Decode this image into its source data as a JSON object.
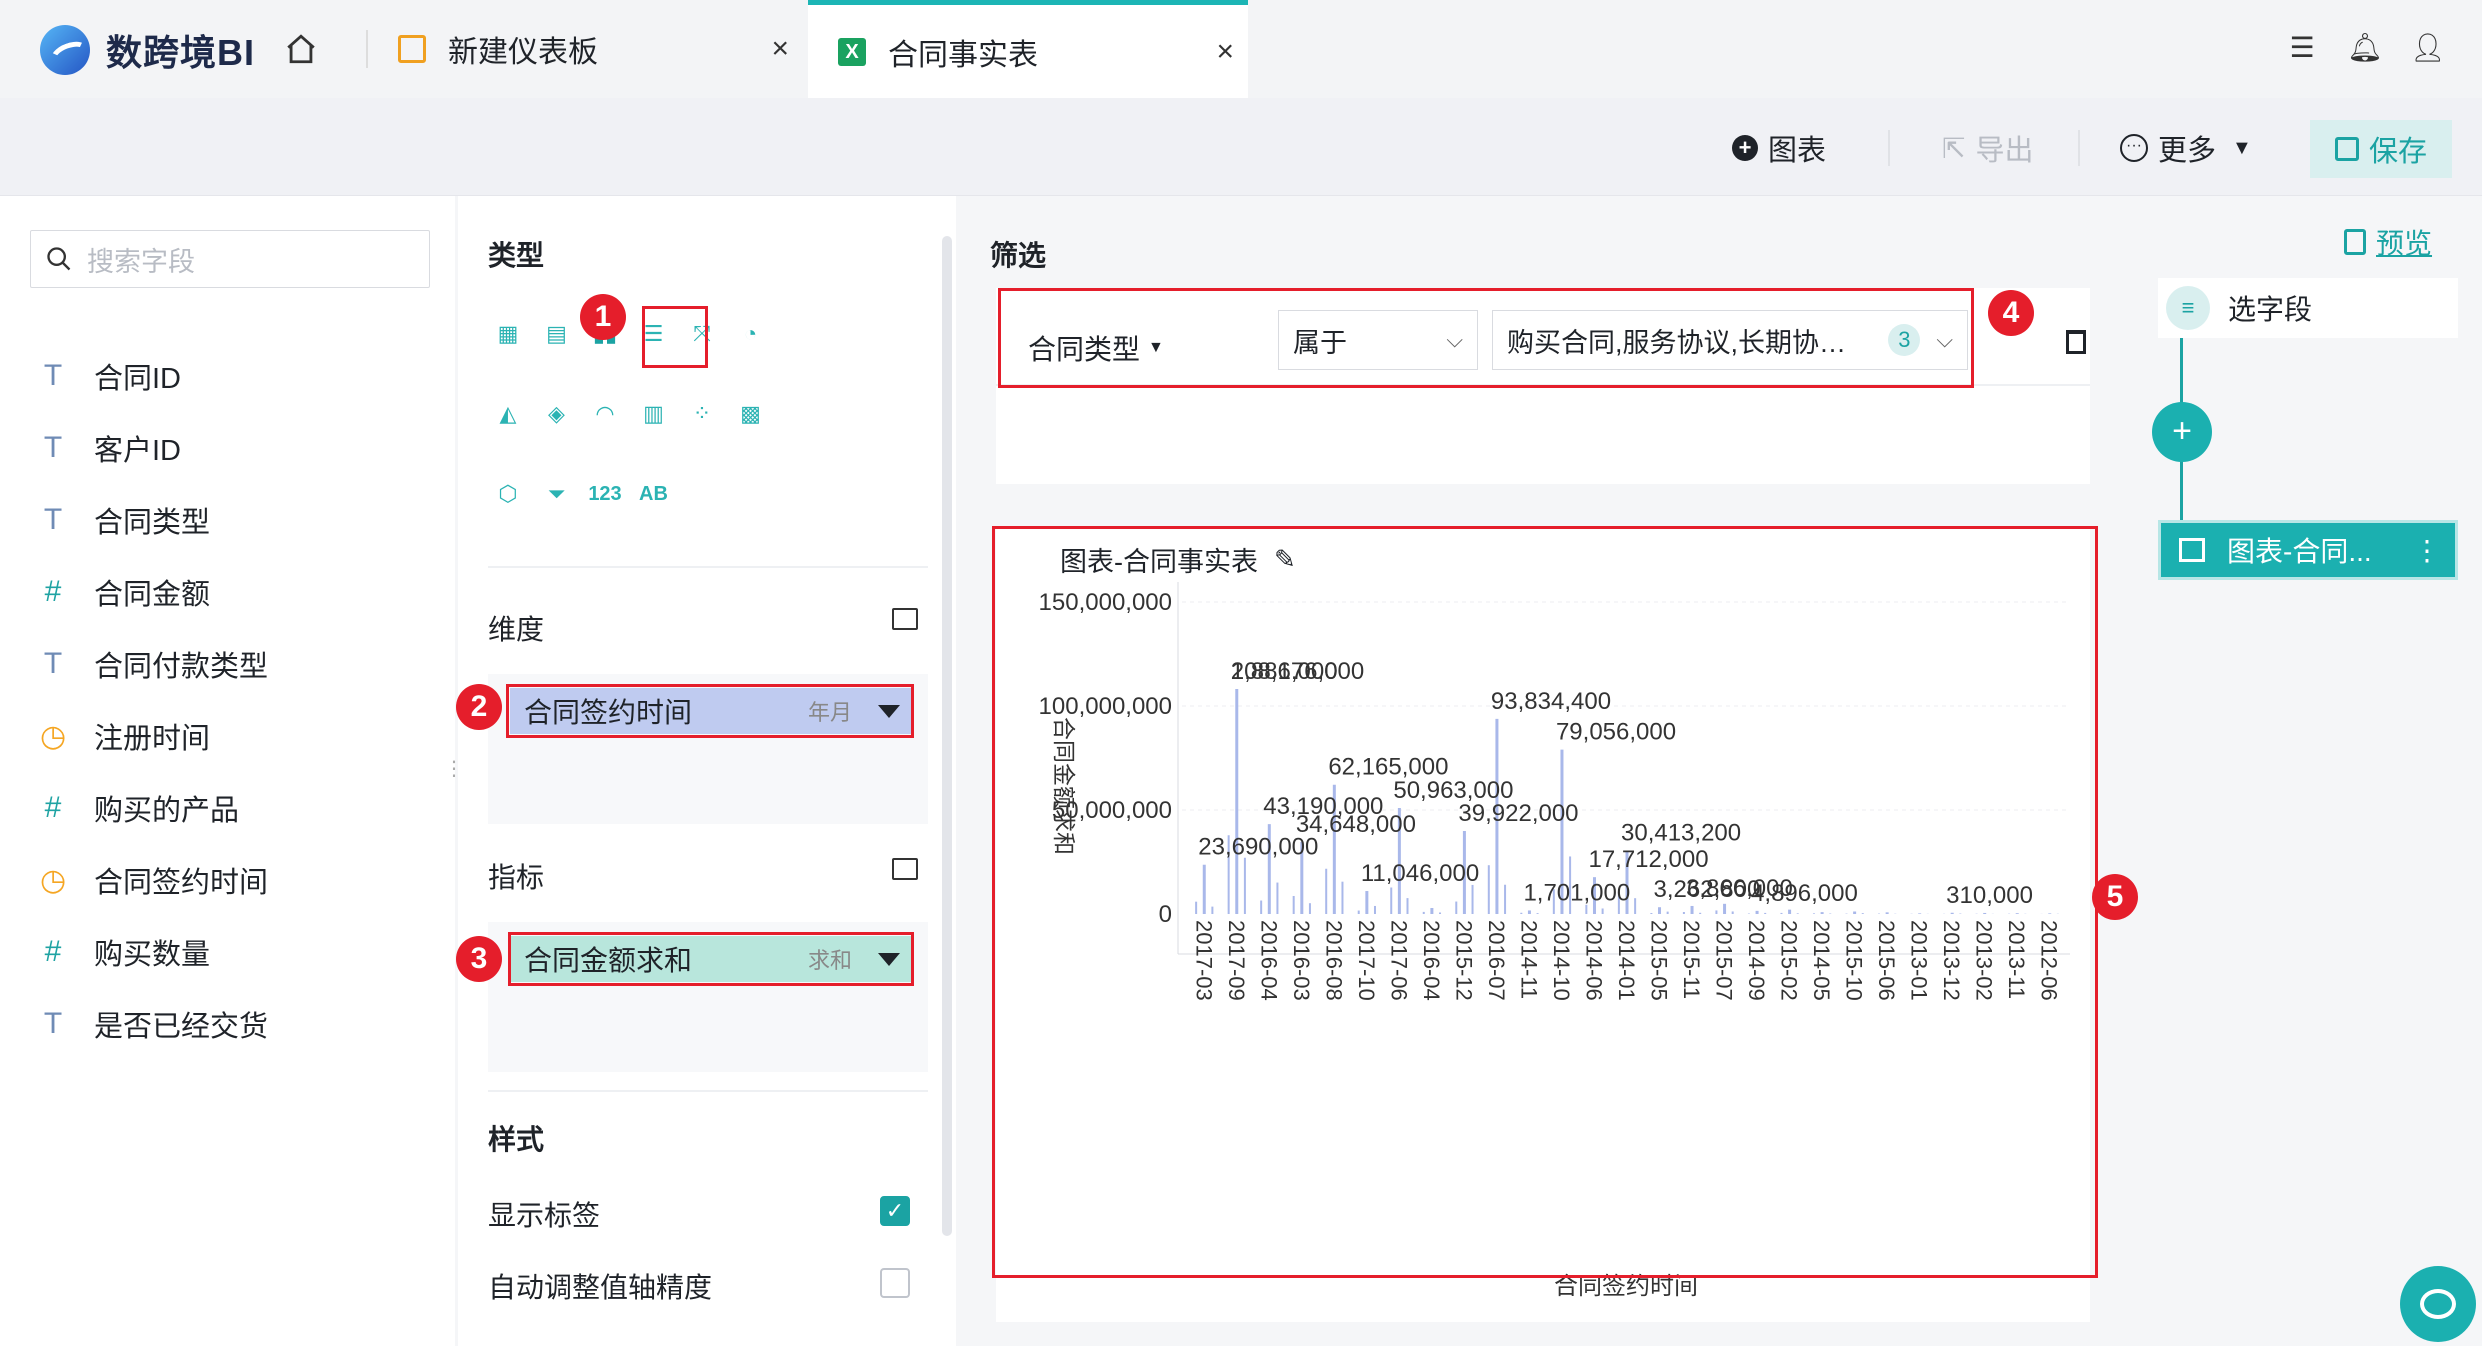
{
  "app": {
    "name": "数跨境BI"
  },
  "tabs": [
    {
      "label": "新建仪表板"
    },
    {
      "label": "合同事实表"
    }
  ],
  "toolbar": {
    "chart": "图表",
    "export": "导出",
    "more": "更多",
    "save": "保存"
  },
  "fields": {
    "search_placeholder": "搜索字段",
    "items": [
      {
        "type": "T",
        "label": "合同ID"
      },
      {
        "type": "T",
        "label": "客户ID"
      },
      {
        "type": "T",
        "label": "合同类型"
      },
      {
        "type": "#",
        "label": "合同金额"
      },
      {
        "type": "T",
        "label": "合同付款类型"
      },
      {
        "type": "D",
        "label": "注册时间"
      },
      {
        "type": "#",
        "label": "购买的产品"
      },
      {
        "type": "D",
        "label": "合同签约时间"
      },
      {
        "type": "#",
        "label": "购买数量"
      },
      {
        "type": "T",
        "label": "是否已经交货"
      }
    ]
  },
  "config": {
    "type_title": "类型",
    "dimension_title": "维度",
    "dimension_pill": {
      "label": "合同签约时间",
      "agg": "年月"
    },
    "metric_title": "指标",
    "metric_pill": {
      "label": "合同金额求和",
      "agg": "求和"
    },
    "style_title": "样式",
    "show_labels": {
      "label": "显示标签",
      "checked": true
    },
    "auto_axis": {
      "label": "自动调整值轴精度",
      "checked": false
    },
    "chart_icons": [
      "table-icon",
      "cross-table-icon",
      "bar-chart-icon",
      "horizontal-bar-icon",
      "line-chart-icon",
      "pie-chart-icon",
      "area-chart-icon",
      "china-map-icon",
      "gauge-icon",
      "stacked-bar-icon",
      "scatter-icon",
      "treemap-icon",
      "radar-icon",
      "funnel-icon",
      "number-card-icon",
      "word-cloud-icon"
    ],
    "number_card_text": "123",
    "word_cloud_text": "AB"
  },
  "filter": {
    "title": "筛选",
    "field": "合同类型",
    "op": "属于",
    "values": "购买合同,服务协议,长期协…",
    "count": "3"
  },
  "chart_title": "图表-合同事实表",
  "chart_data": {
    "type": "bar",
    "xlabel": "合同签约时间",
    "ylabel": "合同金额求和",
    "ylim": [
      0,
      150000000
    ],
    "yticks": [
      "150,000,000",
      "100,000,000",
      "50,000,000",
      "0"
    ],
    "categories": [
      "2017-03",
      "2017-09",
      "2016-04",
      "2016-03",
      "2016-08",
      "2017-10",
      "2017-06",
      "2016-04",
      "2015-12",
      "2016-07",
      "2014-11",
      "2014-10",
      "2014-06",
      "2014-01",
      "2015-05",
      "2015-11",
      "2015-07",
      "2014-09",
      "2015-02",
      "2014-05",
      "2015-10",
      "2015-06",
      "2013-01",
      "2013-12",
      "2013-02",
      "2013-11",
      "2012-06"
    ],
    "values": [
      23690000,
      108176000,
      43190000,
      34648000,
      62165000,
      11046000,
      50963000,
      2886000,
      39922000,
      93834400,
      1701000,
      79056000,
      17712000,
      30413200,
      3262800,
      3866000,
      4896000,
      1500000,
      2100000,
      900000,
      1200000,
      800000,
      310000,
      600000,
      500000,
      400000,
      300000
    ],
    "value_labels": [
      {
        "text": "108,176,000"
      },
      {
        "text": "93,834,400"
      },
      {
        "text": "79,056,000"
      },
      {
        "text": "62,165,000"
      },
      {
        "text": "50,963,000"
      },
      {
        "text": "43,190,000"
      },
      {
        "text": "39,922,000"
      },
      {
        "text": "34,648,000"
      },
      {
        "text": "30,413,200"
      },
      {
        "text": "23,690,000"
      },
      {
        "text": "17,712,000"
      },
      {
        "text": "11,046,000"
      },
      {
        "text": "2,886,000"
      },
      {
        "text": "1,701,000"
      },
      {
        "text": "3,262,800"
      },
      {
        "text": "3,866,000"
      },
      {
        "text": "4,896,000"
      },
      {
        "text": "310,000"
      }
    ]
  },
  "flow": {
    "preview": "预览",
    "step1": "选字段",
    "step2": "图表-合同..."
  },
  "badges": [
    "1",
    "2",
    "3",
    "4",
    "5"
  ],
  "colors": {
    "accent": "#1ba3a3",
    "bar": "#a9b8ea",
    "annot": "#e51e2b"
  }
}
